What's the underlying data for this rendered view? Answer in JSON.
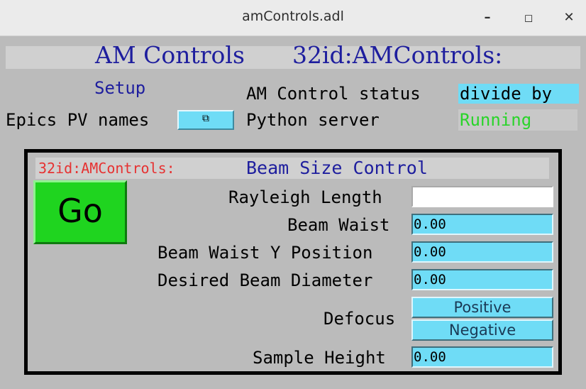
{
  "window": {
    "title": "amControls.adl",
    "minimize_icon": "minimize-icon",
    "maximize_icon": "maximize-icon",
    "close_icon": "close-icon"
  },
  "header": {
    "title": "AM Controls",
    "prefix": "32id:AMControls:"
  },
  "setup": {
    "label": "Setup",
    "epics_label": "Epics PV names",
    "related_display_icon": "related-display-icon"
  },
  "status": {
    "am_label": "AM Control status",
    "am_value": "divide by",
    "python_label": "Python server",
    "python_value": "Running",
    "python_color": "#2ad42a"
  },
  "panel": {
    "prefix": "32id:AMControls:",
    "title": "Beam Size Control",
    "go_label": "Go",
    "go_color": "#1fd41f",
    "fields": [
      {
        "label": "Rayleigh Length",
        "value": ""
      },
      {
        "label": "Beam Waist",
        "value": "0.00"
      },
      {
        "label": "Beam Waist Y Position",
        "value": "0.00"
      },
      {
        "label": "Desired Beam Diameter",
        "value": "0.00"
      }
    ],
    "defocus_label": "Defocus",
    "defocus_options": [
      "Positive",
      "Negative"
    ],
    "sample_height_label": "Sample Height",
    "sample_height_value": "0.00"
  },
  "colors": {
    "field_bg": "#6fdcf6",
    "header_text": "#1e1e9e",
    "prefix_text": "#e63232"
  }
}
